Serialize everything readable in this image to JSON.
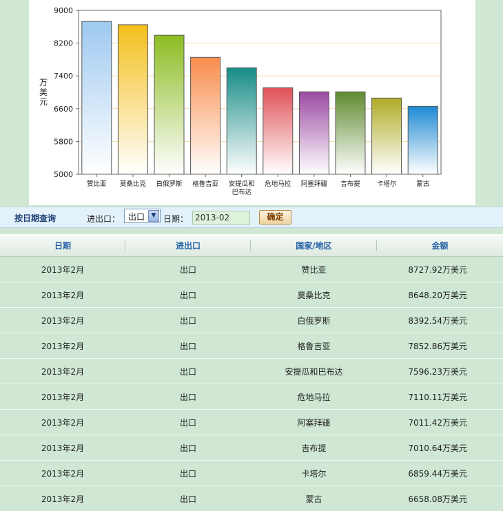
{
  "chart_data": {
    "type": "bar",
    "ylabel": "万美元",
    "ylim": [
      5000,
      9000
    ],
    "yticks": [
      5000,
      5800,
      6600,
      7400,
      8200,
      9000
    ],
    "grid": true,
    "categories": [
      "赞比亚",
      "莫桑比克",
      "白俄罗斯",
      "格鲁吉亚",
      "安提瓜和巴布达",
      "危地马拉",
      "阿塞拜疆",
      "吉布提",
      "卡塔尔",
      "蒙古"
    ],
    "values": [
      8727.92,
      8648.2,
      8392.54,
      7852.86,
      7596.23,
      7110.11,
      7011.42,
      7010.64,
      6859.44,
      6658.08
    ],
    "colors": [
      "#9ec9f0",
      "#f3bf1b",
      "#8cbc22",
      "#f98c4c",
      "#168c86",
      "#e05257",
      "#9b4aa2",
      "#5f8a2f",
      "#aeac26",
      "#1f8ad4"
    ]
  },
  "query": {
    "title": "按日期查询",
    "direction_label": "进出口：",
    "direction_value": "出口",
    "date_label": "日期：",
    "date_value": "2013-02",
    "confirm_label": "确定"
  },
  "table": {
    "headers": [
      "日期",
      "进出口",
      "国家/地区",
      "金额"
    ],
    "rows": [
      [
        "2013年2月",
        "出口",
        "赞比亚",
        "8727.92万美元"
      ],
      [
        "2013年2月",
        "出口",
        "莫桑比克",
        "8648.20万美元"
      ],
      [
        "2013年2月",
        "出口",
        "白俄罗斯",
        "8392.54万美元"
      ],
      [
        "2013年2月",
        "出口",
        "格鲁吉亚",
        "7852.86万美元"
      ],
      [
        "2013年2月",
        "出口",
        "安提瓜和巴布达",
        "7596.23万美元"
      ],
      [
        "2013年2月",
        "出口",
        "危地马拉",
        "7110.11万美元"
      ],
      [
        "2013年2月",
        "出口",
        "阿塞拜疆",
        "7011.42万美元"
      ],
      [
        "2013年2月",
        "出口",
        "吉布提",
        "7010.64万美元"
      ],
      [
        "2013年2月",
        "出口",
        "卡塔尔",
        "6859.44万美元"
      ],
      [
        "2013年2月",
        "出口",
        "蒙古",
        "6658.08万美元"
      ]
    ]
  }
}
